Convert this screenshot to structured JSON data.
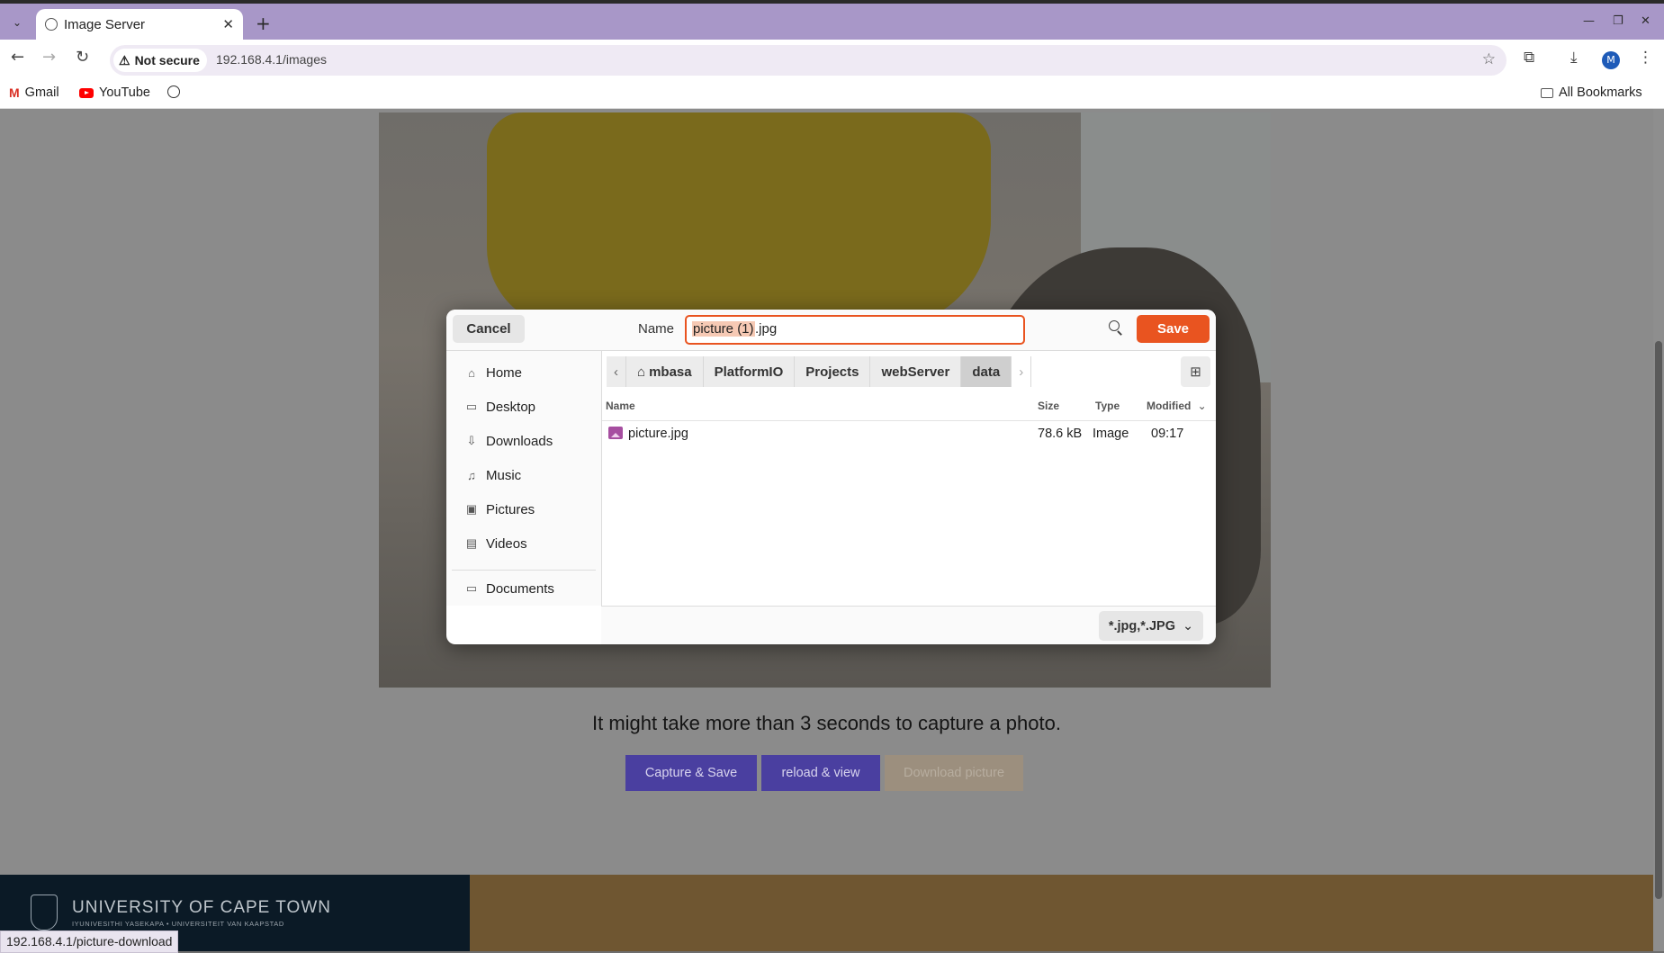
{
  "browser": {
    "tab_title": "Image Server",
    "new_tab": "+",
    "omnibox": {
      "security_label": "Not secure",
      "url": "192.168.4.1/images"
    },
    "avatar_letter": "M",
    "bookmarks": [
      {
        "label": "Gmail",
        "icon": "gmail-icon"
      },
      {
        "label": "YouTube",
        "icon": "youtube-icon"
      },
      {
        "label": "",
        "icon": "globe-icon"
      }
    ],
    "all_bookmarks": "All Bookmarks",
    "status_url": "192.168.4.1/picture-download"
  },
  "page": {
    "caption": "It might take more than 3 seconds to capture a photo.",
    "buttons": [
      {
        "label": "Capture & Save",
        "color": "#4a3fa0"
      },
      {
        "label": "reload & view",
        "color": "#4a3fa0"
      },
      {
        "label": "Download picture",
        "color": "#9c8f7e"
      }
    ],
    "footer": {
      "name": "UNIVERSITY OF CAPE TOWN",
      "subtitle": "IYUNIVESITHI YASEKAPA • UNIVERSITEIT VAN KAAPSTAD"
    }
  },
  "dialog": {
    "cancel": "Cancel",
    "name_label": "Name",
    "filename_selected": "picture (1)",
    "filename_ext": ".jpg",
    "save": "Save",
    "accent": "#e95420",
    "places": [
      {
        "label": "Home",
        "icon": "home-icon",
        "glyph": "⌂"
      },
      {
        "label": "Desktop",
        "icon": "desktop-icon",
        "glyph": "▭"
      },
      {
        "label": "Downloads",
        "icon": "download-icon",
        "glyph": "⇩"
      },
      {
        "label": "Music",
        "icon": "music-icon",
        "glyph": "♫"
      },
      {
        "label": "Pictures",
        "icon": "picture-icon",
        "glyph": "▣"
      },
      {
        "label": "Videos",
        "icon": "video-icon",
        "glyph": "▤"
      },
      {
        "label": "Documents",
        "icon": "folder-icon",
        "glyph": "▭"
      }
    ],
    "path": [
      "mbasa",
      "PlatformIO",
      "Projects",
      "webServer",
      "data"
    ],
    "columns": {
      "name": "Name",
      "size": "Size",
      "type": "Type",
      "modified": "Modified"
    },
    "files": [
      {
        "name": "picture.jpg",
        "size": "78.6 kB",
        "type": "Image",
        "modified": "09:17"
      }
    ],
    "filter": "*.jpg,*.JPG"
  }
}
